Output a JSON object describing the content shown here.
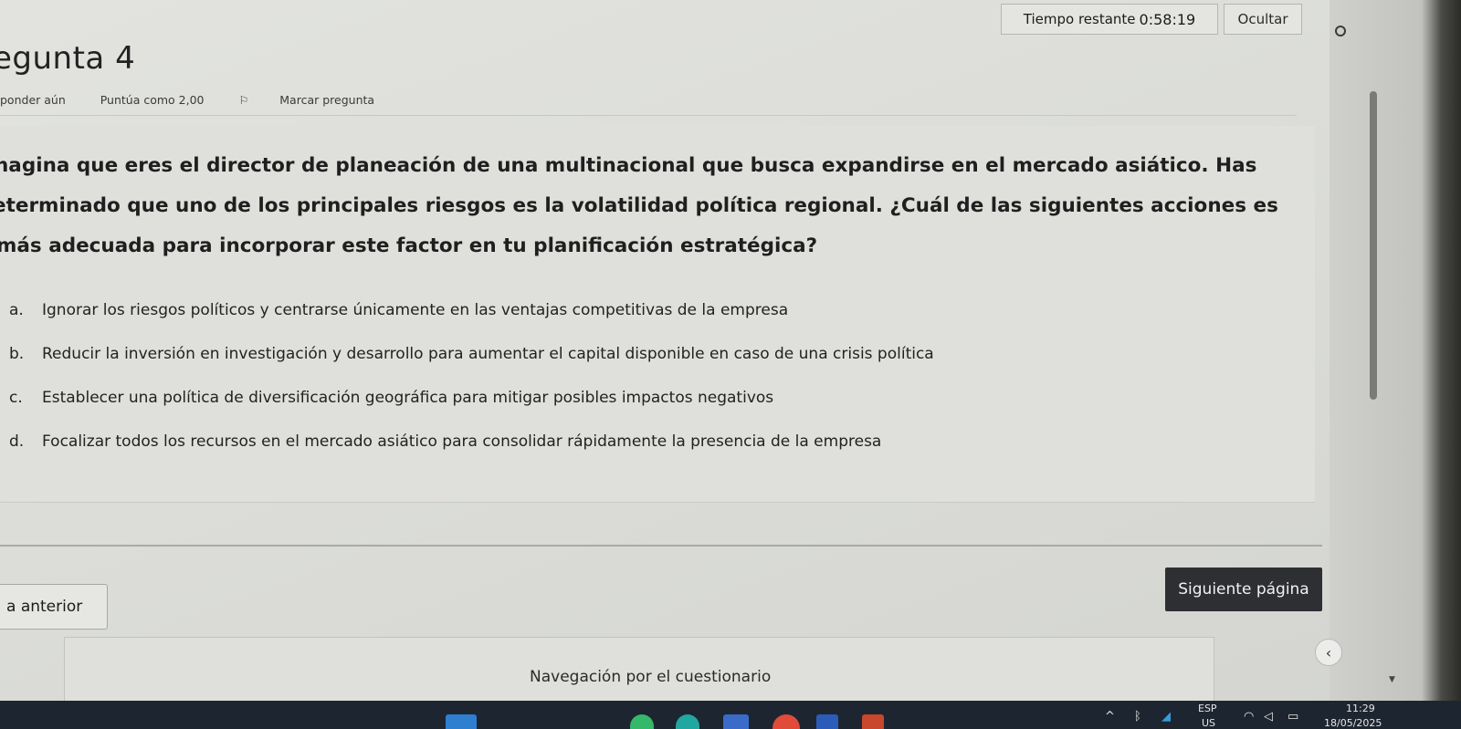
{
  "timer": {
    "label": "Tiempo restante",
    "value": "0:58:19",
    "hide_label": "Ocultar"
  },
  "question": {
    "title": "egunta 4",
    "status": "ponder aún",
    "points": "Puntúa como 2,00",
    "flag_label": "Marcar pregunta",
    "text_lines": [
      "nagina que eres el director de planeación de una multinacional que busca expandirse en el mercado asiático. Has",
      "eterminado que uno de los principales riesgos es la volatilidad política regional. ¿Cuál de las siguientes acciones es",
      "más adecuada para incorporar este factor en tu planificación estratégica?"
    ]
  },
  "answers": [
    {
      "letter": "a.",
      "text": "Ignorar los riesgos políticos y centrarse únicamente en las ventajas competitivas de la empresa"
    },
    {
      "letter": "b.",
      "text": "Reducir la inversión en investigación y desarrollo para aumentar el capital disponible en caso de una crisis política"
    },
    {
      "letter": "c.",
      "text": "Establecer una política de diversificación geográfica para mitigar posibles impactos negativos"
    },
    {
      "letter": "d.",
      "text": "Focalizar todos los recursos en el mercado asiático para consolidar rápidamente la presencia de la empresa"
    }
  ],
  "navigation": {
    "prev_label": "a anterior",
    "next_label": "Siguiente página",
    "quiz_nav_title": "Navegación por el cuestionario"
  },
  "taskbar": {
    "lang_top": "ESP",
    "lang_bottom": "US",
    "time": "11:29",
    "date": "18/05/2025"
  },
  "icons": [
    "ring-icon",
    "flag-icon",
    "chevron-left-icon",
    "chevron-down-icon",
    "wifi-icon",
    "speaker-icon",
    "battery-icon",
    "chevron-up-icon",
    "bluetooth-icon"
  ]
}
